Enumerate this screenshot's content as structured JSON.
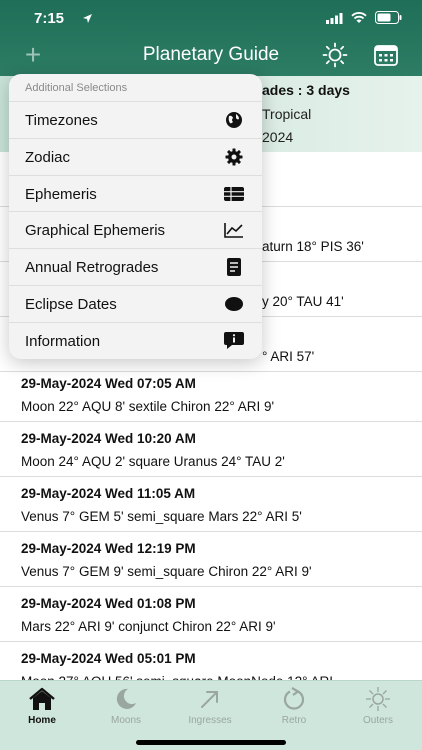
{
  "status": {
    "time": "7:15"
  },
  "nav": {
    "title": "Planetary Guide",
    "plus": "+"
  },
  "summary": {
    "line1": "ades : 3 days",
    "line2": "Tropical",
    "line3": "2024"
  },
  "menu": {
    "header": "Additional Selections",
    "items": [
      {
        "label": "Timezones",
        "icon": "globe-icon"
      },
      {
        "label": "Zodiac",
        "icon": "gear-icon"
      },
      {
        "label": "Ephemeris",
        "icon": "table-icon"
      },
      {
        "label": "Graphical Ephemeris",
        "icon": "chart-line-icon"
      },
      {
        "label": "Annual Retrogrades",
        "icon": "document-icon"
      },
      {
        "label": "Eclipse Dates",
        "icon": "ellipse-icon"
      },
      {
        "label": "Information",
        "icon": "info-bubble-icon"
      }
    ]
  },
  "events": [
    {
      "head": "",
      "desc": "",
      "desc_right": ""
    },
    {
      "head": "",
      "desc": "",
      "desc_right": "aturn 18° PIS 36'"
    },
    {
      "head": "",
      "desc": "",
      "desc_right": "y 20° TAU 41'"
    },
    {
      "head": "",
      "desc": "",
      "desc_right": "° ARI 57'"
    },
    {
      "head": "29-May-2024  Wed  07:05 AM",
      "desc": "Moon 22° AQU 8'  sextile Chiron 22° ARI 9'",
      "desc_right": ""
    },
    {
      "head": "29-May-2024  Wed  10:20 AM",
      "desc": "Moon 24° AQU 2'  square Uranus 24° TAU 2'",
      "desc_right": ""
    },
    {
      "head": "29-May-2024  Wed  11:05 AM",
      "desc": "Venus 7° GEM 5'  semi_square Mars 22° ARI 5'",
      "desc_right": ""
    },
    {
      "head": "29-May-2024  Wed  12:19 PM",
      "desc": "Venus 7° GEM 9'  semi_square Chiron 22° ARI 9'",
      "desc_right": ""
    },
    {
      "head": "29-May-2024  Wed  01:08 PM",
      "desc": "Mars 22° ARI 9'  conjunct Chiron 22° ARI 9'",
      "desc_right": ""
    },
    {
      "head": "29-May-2024  Wed  05:01 PM",
      "desc": "Moon 27° AQU 56'  semi_square MoonNode 12° ARI",
      "desc_right": ""
    }
  ],
  "tabs": [
    {
      "label": "Home",
      "icon": "home-icon",
      "active": true
    },
    {
      "label": "Moons",
      "icon": "moon-icon",
      "active": false
    },
    {
      "label": "Ingresses",
      "icon": "arrow-up-right-icon",
      "active": false
    },
    {
      "label": "Retro",
      "icon": "retro-cycle-icon",
      "active": false
    },
    {
      "label": "Outers",
      "icon": "outers-sun-icon",
      "active": false
    }
  ],
  "colors": {
    "header": "#1f6f58",
    "summary": "#c8e3d8",
    "tabbar": "#cfe6dc"
  }
}
